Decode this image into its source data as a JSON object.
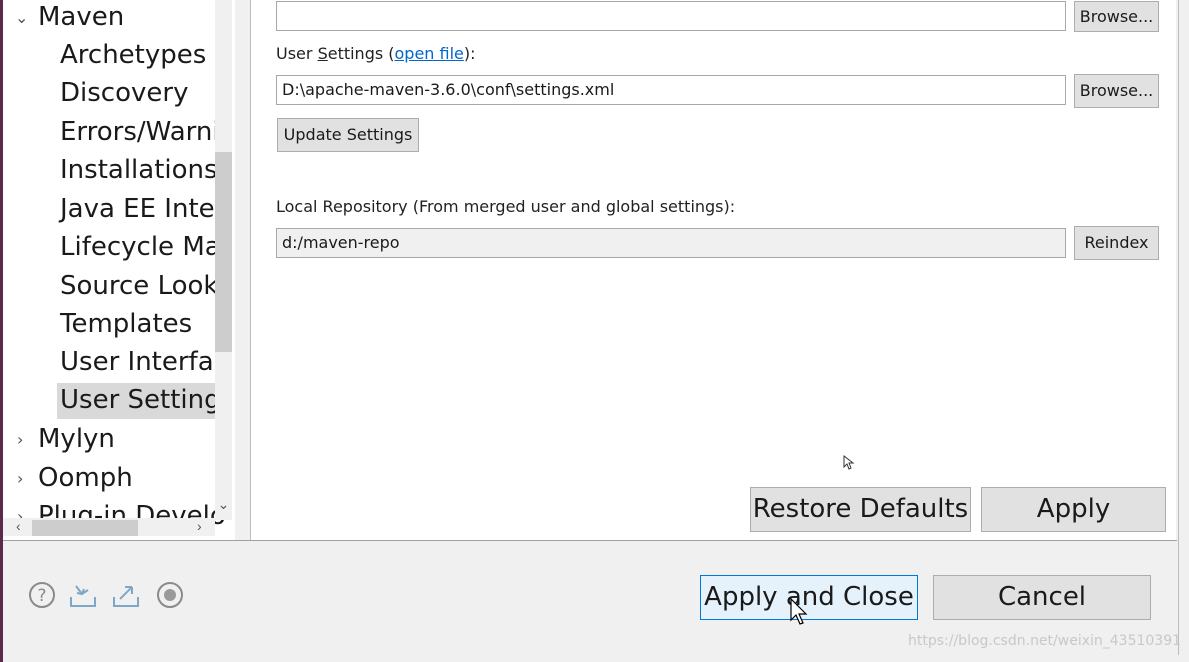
{
  "tree": {
    "items": [
      {
        "label": "Maven",
        "expanded": true
      },
      {
        "label": "Archetypes"
      },
      {
        "label": "Discovery"
      },
      {
        "label": "Errors/Warni"
      },
      {
        "label": "Installations"
      },
      {
        "label": "Java EE Integ"
      },
      {
        "label": "Lifecycle Ma"
      },
      {
        "label": "Source Look"
      },
      {
        "label": "Templates"
      },
      {
        "label": "User Interfac"
      },
      {
        "label": "User Setting",
        "selected": true
      },
      {
        "label": "Mylyn",
        "expanded": false
      },
      {
        "label": "Oomph",
        "expanded": false
      },
      {
        "label": "Plug-in Develo",
        "expanded": false
      }
    ]
  },
  "settings": {
    "global_settings_value": "",
    "browse_label": "Browse...",
    "user_settings_label_prefix": "User ",
    "user_settings_label_mnemonic": "S",
    "user_settings_label_rest": "ettings (",
    "open_file_link": "open file",
    "user_settings_label_suffix": "):",
    "user_settings_value": "D:\\apache-maven-3.6.0\\conf\\settings.xml",
    "update_settings_label": "Update Settings",
    "local_repo_label": "Local Repository (From merged user and global settings):",
    "local_repo_value": "d:/maven-repo",
    "reindex_label": "Reindex"
  },
  "page_buttons": {
    "restore_defaults": "Restore Defaults",
    "apply": "Apply"
  },
  "footer": {
    "icons": [
      "help-icon",
      "import-icon",
      "export-icon",
      "record-icon"
    ],
    "apply_and_close": "Apply and Close",
    "cancel": "Cancel"
  },
  "watermark": "https://blog.csdn.net/weixin_43510391"
}
